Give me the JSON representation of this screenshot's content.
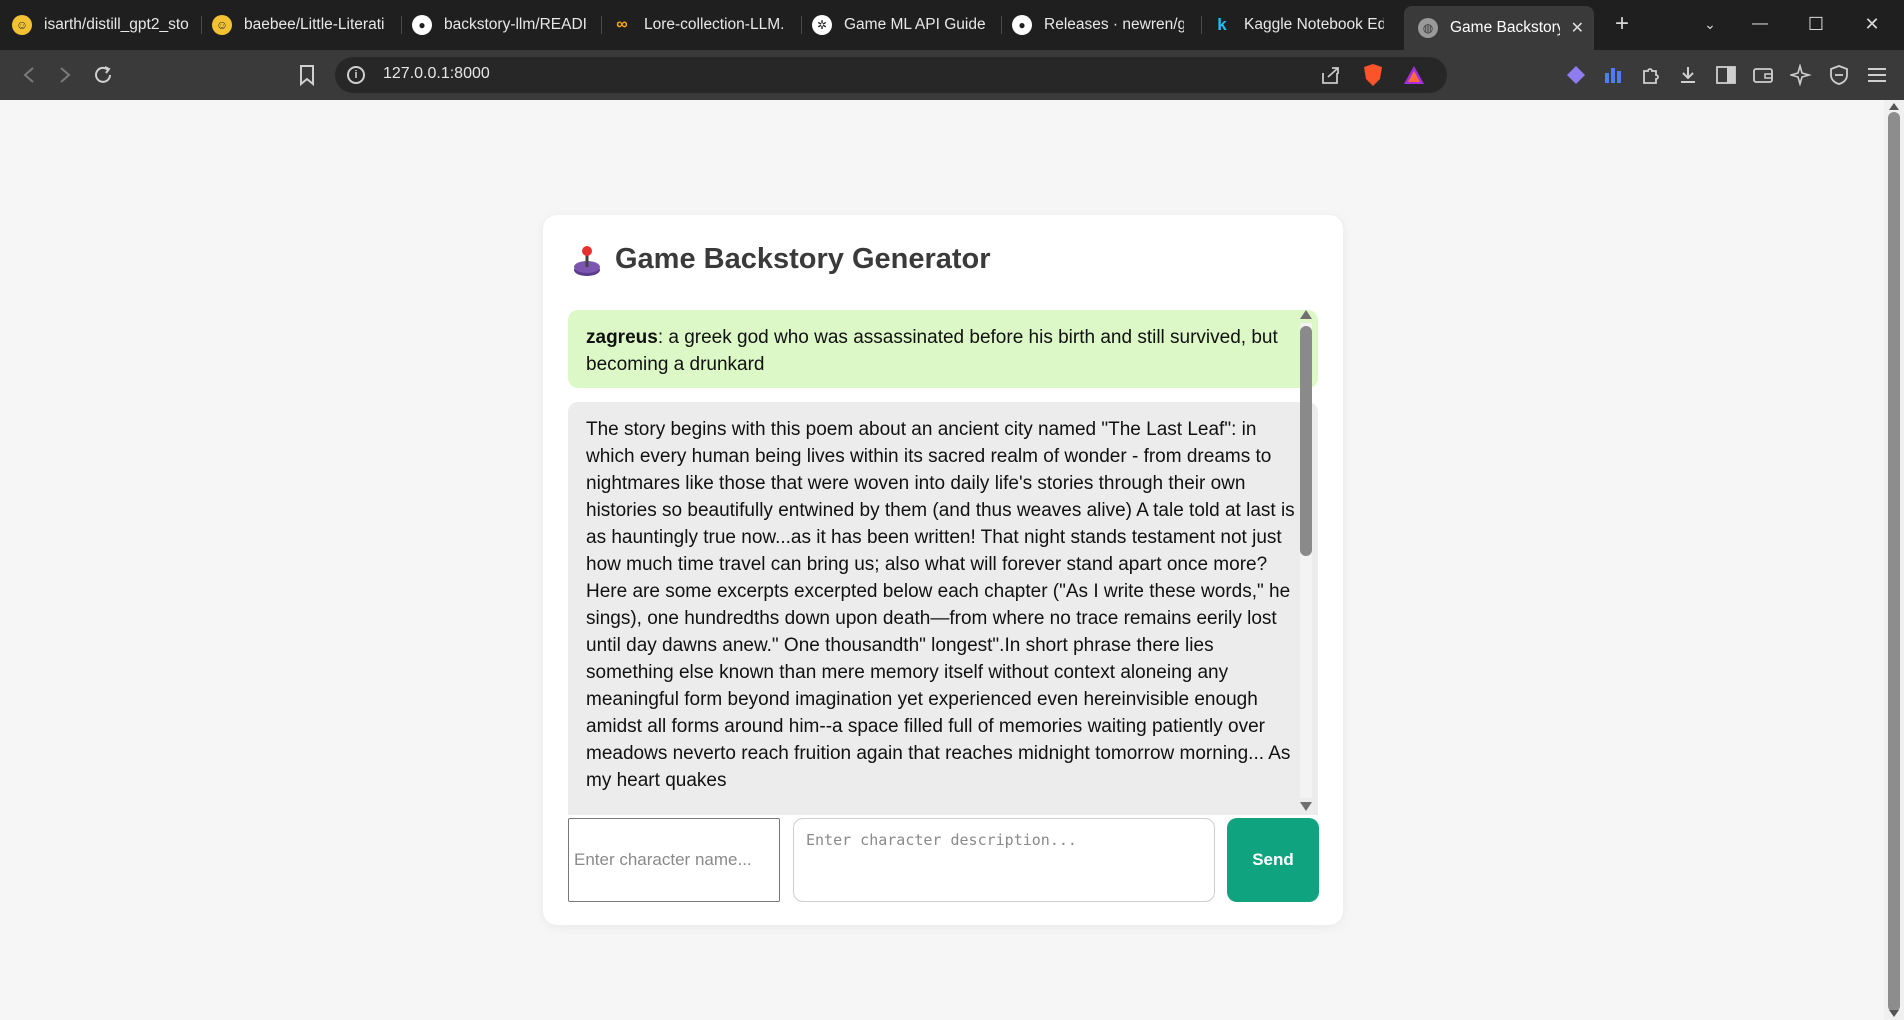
{
  "browser": {
    "tabs": [
      {
        "title": "isarth/distill_gpt2_sto",
        "icon": "huggingface-icon"
      },
      {
        "title": "baebee/Little-Literati",
        "icon": "huggingface-icon"
      },
      {
        "title": "backstory-llm/READI",
        "icon": "github-icon"
      },
      {
        "title": "Lore-collection-LLM.",
        "icon": "colab-icon"
      },
      {
        "title": "Game ML API Guide",
        "icon": "openai-icon"
      },
      {
        "title": "Releases · newren/gi",
        "icon": "github-icon"
      },
      {
        "title": "Kaggle Notebook Ed",
        "icon": "kaggle-icon"
      },
      {
        "title": "Game Backstory",
        "icon": "globe-icon",
        "active": true
      }
    ],
    "new_tab": "+",
    "address": "127.0.0.1:8000",
    "window_controls": {
      "minimize": "—",
      "maximize": "☐",
      "close": "✕"
    }
  },
  "app": {
    "title": "Game Backstory Generator",
    "title_icon": "joystick-icon",
    "messages": [
      {
        "role": "user",
        "name": "zagreus",
        "text": ": a greek god who was assassinated before his birth and still survived, but becoming a drunkard"
      },
      {
        "role": "bot",
        "text": "The story begins with this poem about an ancient city named \"The Last Leaf\": in which every human being lives within its sacred realm of wonder - from dreams to nightmares like those that were woven into daily life's stories through their own histories so beautifully entwined by them (and thus weaves alive)  A tale told at last is as hauntingly true now...as it has been written! That night stands testament not just how much time travel can bring us; also what will forever stand apart once more? Here are some excerpts excerpted below each chapter (\"As I write these words,\" he sings), one hundredths down upon death—from where no trace remains eerily lost until day dawns anew.\" One thousandth\" longest\".In short phrase there lies something else known than mere memory itself without context aloneing any meaningful form beyond imagination yet experienced even hereinvisible enough amidst all forms around him--a space filled full of memories waiting patiently over meadows neverto reach fruition again that reaches midnight tomorrow morning... As my heart quakes"
      }
    ],
    "name_placeholder": "Enter character name...",
    "description_placeholder": "Enter character description...",
    "send_label": "Send",
    "colors": {
      "send": "#10a37f",
      "user_bubble": "#dcf8c6",
      "bot_bubble": "#ececec"
    }
  }
}
